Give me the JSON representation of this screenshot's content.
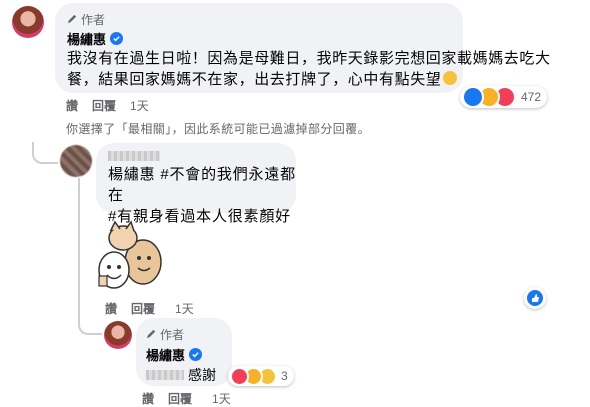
{
  "comment1": {
    "author_tag": "作者",
    "name": "楊繡惠",
    "text_line1": "我沒有在過生日啦！因為是母難日，我昨天錄影完想回家載媽媽去吃大",
    "text_line2": "餐，結果回家媽媽不在家，出去打牌了，心中有點失望",
    "reaction_count": "472",
    "actions": {
      "like": "讚",
      "reply": "回覆",
      "time": "1天"
    }
  },
  "filter_note": "你選擇了「最相關」，因此系統可能已過濾掉部分回覆。",
  "reply1": {
    "line1": "楊繡惠 #不會的我們永遠都在",
    "line2": "#有親身看過本人很素顏好看",
    "actions": {
      "like": "讚",
      "reply": "回覆",
      "time": "1天"
    }
  },
  "reply2": {
    "author_tag": "作者",
    "name": "楊繡惠",
    "text": "感謝",
    "reaction_count": "3",
    "actions": {
      "like": "讚",
      "reply": "回覆",
      "time": "1天"
    }
  },
  "colors": {
    "verified": "#1877f2",
    "like": "#1877f2",
    "bubble": "#f0f2f5",
    "meta": "#65676b"
  }
}
